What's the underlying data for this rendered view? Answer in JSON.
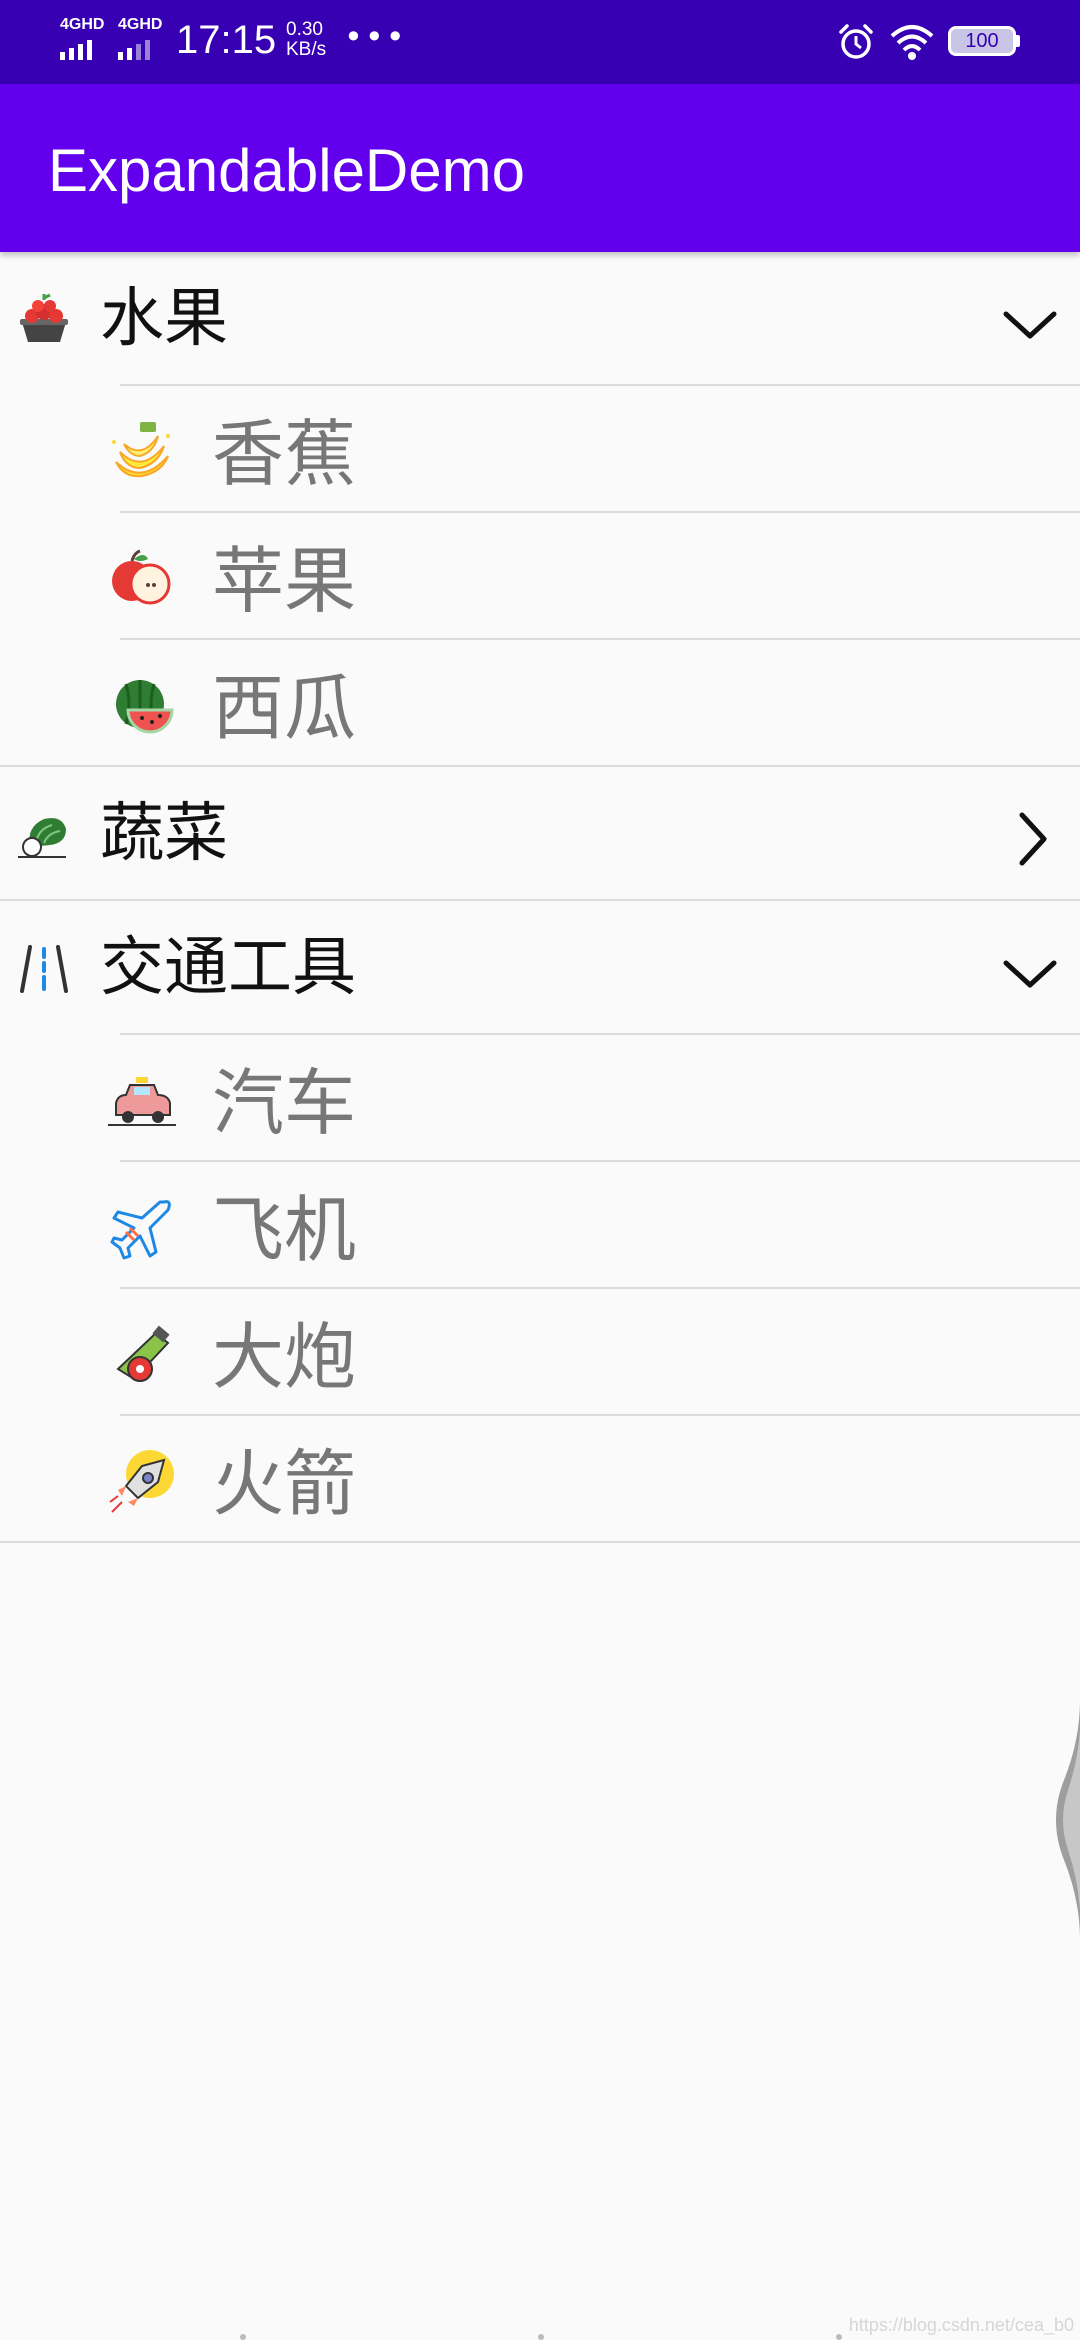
{
  "status_bar": {
    "network1": "4GHD",
    "network2": "4GHD",
    "time": "17:15",
    "speed_value": "0.30",
    "speed_unit": "KB/s",
    "more": "•••",
    "battery": "100",
    "icons": [
      "alarm-icon",
      "wifi-icon",
      "battery-icon"
    ]
  },
  "app_bar": {
    "title": "ExpandableDemo",
    "color": "#6200ee"
  },
  "list": {
    "groups": [
      {
        "label": "水果",
        "icon": "fruit-basket-icon",
        "expanded": true,
        "children": [
          {
            "label": "香蕉",
            "icon": "banana-icon"
          },
          {
            "label": "苹果",
            "icon": "apple-icon"
          },
          {
            "label": "西瓜",
            "icon": "watermelon-icon"
          }
        ]
      },
      {
        "label": "蔬菜",
        "icon": "vegetable-icon",
        "expanded": false,
        "children": []
      },
      {
        "label": "交通工具",
        "icon": "road-icon",
        "expanded": true,
        "children": [
          {
            "label": "汽车",
            "icon": "car-icon"
          },
          {
            "label": "飞机",
            "icon": "airplane-icon"
          },
          {
            "label": "大炮",
            "icon": "cannon-icon"
          },
          {
            "label": "火箭",
            "icon": "rocket-icon"
          }
        ]
      }
    ]
  },
  "watermark": "https://blog.csdn.net/cea_b0"
}
